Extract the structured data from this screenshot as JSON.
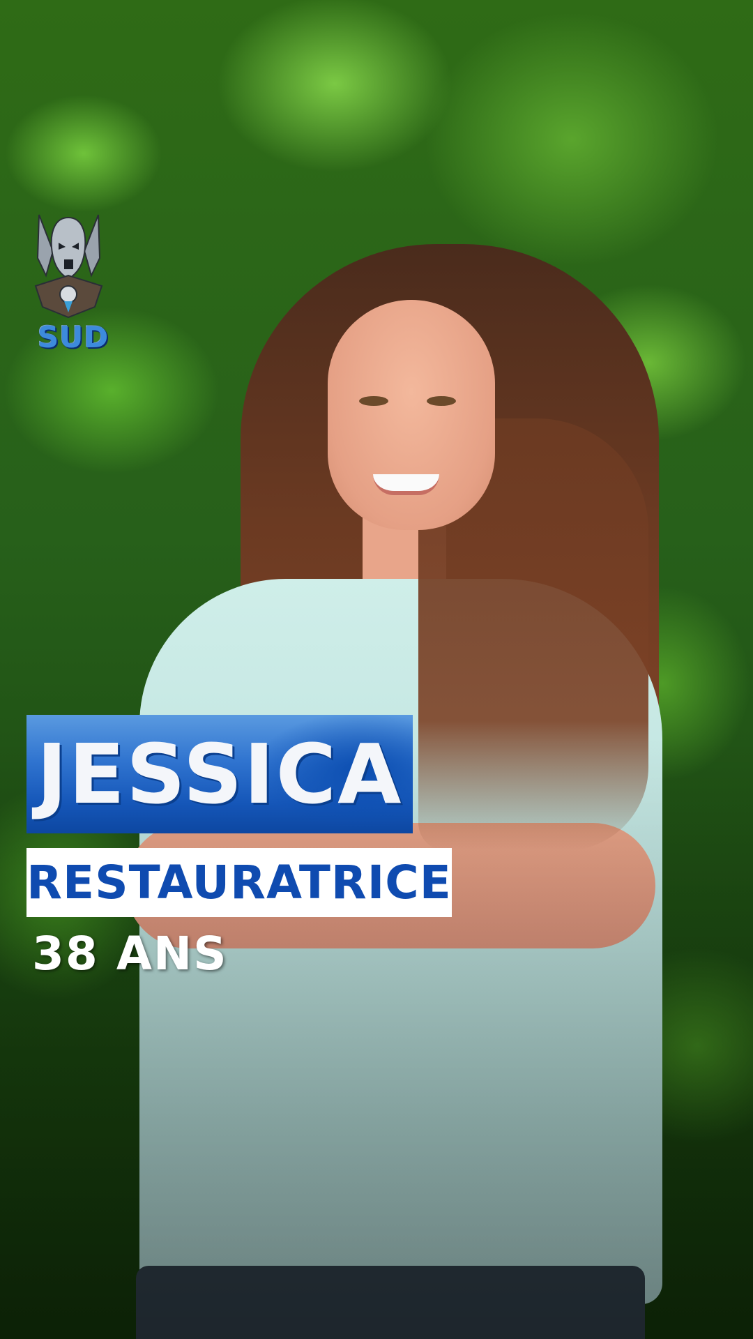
{
  "logo": {
    "tribe_label": "SUD",
    "icon": "tribal-mask-icon"
  },
  "contestant": {
    "name": "JESSICA",
    "occupation": "RESTAURATRICE",
    "age": "38 ANS"
  },
  "colors": {
    "banner_blue": "#1556b8",
    "text_blue": "#0f4bb0",
    "white": "#ffffff"
  }
}
